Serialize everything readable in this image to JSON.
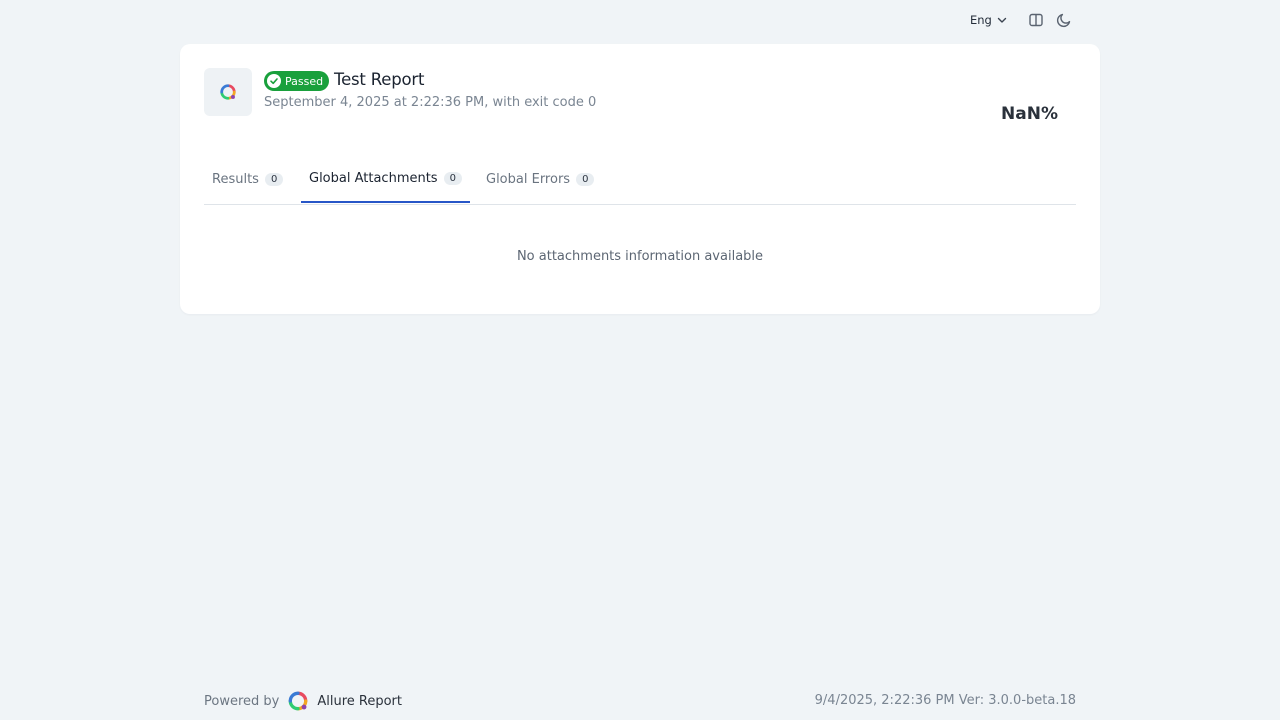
{
  "header": {
    "language": "Eng",
    "icons": {
      "language_chevron": "chevron-down-icon",
      "layout_toggle": "split-layout-icon",
      "theme_toggle": "moon-icon"
    }
  },
  "report": {
    "status": "Passed",
    "status_color": "#19a03c",
    "title": "Test Report",
    "subtitle": "September 4, 2025 at 2:22:36 PM, with exit code 0",
    "success_rate": "NaN%"
  },
  "tabs": [
    {
      "label": "Results",
      "count": "0",
      "active": false
    },
    {
      "label": "Global Attachments",
      "count": "0",
      "active": true
    },
    {
      "label": "Global Errors",
      "count": "0",
      "active": false
    }
  ],
  "tab_accent_color": "#2756c7",
  "content": {
    "empty_message": "No attachments information available"
  },
  "footer": {
    "powered_by": "Powered by",
    "brand": "Allure Report",
    "meta": "9/4/2025, 2:22:36 PM Ver: 3.0.0-beta.18"
  }
}
